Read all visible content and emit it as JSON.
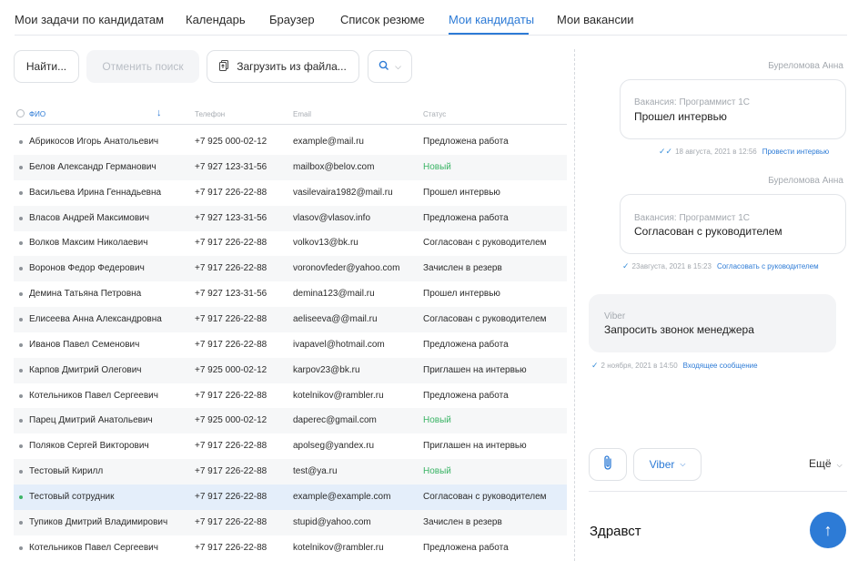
{
  "nav": {
    "tabs": [
      {
        "label": "Мои задачи по кандидатам"
      },
      {
        "label": "Календарь"
      },
      {
        "label": "Браузер"
      },
      {
        "label": "Список резюме"
      },
      {
        "label": "Мои кандидаты",
        "active": true
      },
      {
        "label": "Мои вакансии"
      }
    ]
  },
  "toolbar": {
    "find_label": "Найти...",
    "cancel_label": "Отменить поиск",
    "upload_label": "Загрузить из файла...",
    "icons": {
      "upload": "file-upload-icon",
      "search": "search-icon"
    }
  },
  "table": {
    "columns": [
      "ФИО",
      "Телефон",
      "Email",
      "Статус"
    ],
    "rows": [
      {
        "name": "Абрикосов Игорь Анатольевич",
        "phone": "+7 925 000-02-12",
        "email": "example@mail.ru",
        "status": "Предложена работа"
      },
      {
        "name": "Белов Александр Германович",
        "phone": "+7 927 123-31-56",
        "email": "mailbox@belov.com",
        "status": "Новый"
      },
      {
        "name": "Васильева Ирина Геннадьевна",
        "phone": "+7 917 226-22-88",
        "email": "vasilevaira1982@mail.ru",
        "status": "Прошел интервью"
      },
      {
        "name": "Власов Андрей Максимович",
        "phone": "+7 927 123-31-56",
        "email": "vlasov@vlasov.info",
        "status": "Предложена работа"
      },
      {
        "name": "Волков Максим Николаевич",
        "phone": "+7 917 226-22-88",
        "email": "volkov13@bk.ru",
        "status": "Согласован с руководителем"
      },
      {
        "name": "Воронов Федор Федерович",
        "phone": "+7 917 226-22-88",
        "email": "voronovfeder@yahoo.com",
        "status": "Зачислен в резерв"
      },
      {
        "name": "Демина Татьяна Петровна",
        "phone": "+7 927 123-31-56",
        "email": "demina123@mail.ru",
        "status": "Прошел интервью"
      },
      {
        "name": "Елисеева Анна Александровна",
        "phone": "+7 917 226-22-88",
        "email": "aeliseeva@@mail.ru",
        "status": "Согласован с руководителем"
      },
      {
        "name": "Иванов Павел Семенович",
        "phone": "+7 917 226-22-88",
        "email": "ivapavel@hotmail.com",
        "status": "Предложена работа"
      },
      {
        "name": "Карпов Дмитрий Олегович",
        "phone": "+7 925 000-02-12",
        "email": "karpov23@bk.ru",
        "status": "Приглашен на интервью"
      },
      {
        "name": "Котельников Павел Сергеевич",
        "phone": "+7 917 226-22-88",
        "email": "kotelnikov@rambler.ru",
        "status": "Предложена работа"
      },
      {
        "name": "Парец Дмитрий Анатольевич",
        "phone": "+7 925 000-02-12",
        "email": "daperec@gmail.com",
        "status": "Новый"
      },
      {
        "name": "Поляков Сергей Викторович",
        "phone": "+7 917 226-22-88",
        "email": "apolseg@yandex.ru",
        "status": "Приглашен на интервью"
      },
      {
        "name": "Тестовый Кирилл",
        "phone": "+7 917 226-22-88",
        "email": "test@ya.ru",
        "status": "Новый"
      },
      {
        "name": "Тестовый сотрудник",
        "phone": "+7 917 226-22-88",
        "email": "example@example.com",
        "status": "Согласован с руководителем",
        "selected": true
      },
      {
        "name": "Тупиков Дмитрий Владимирович",
        "phone": "+7 917 226-22-88",
        "email": "stupid@yahoo.com",
        "status": "Зачислен в резерв"
      },
      {
        "name": "Котельников Павел Сергеевич",
        "phone": "+7 917 226-22-88",
        "email": "kotelnikov@rambler.ru",
        "status": "Предложена работа"
      }
    ]
  },
  "chat": {
    "messages": [
      {
        "author": "Буреломова Анна",
        "label": "Вакансия: Программист 1С",
        "text": "Прошел интервью",
        "meta": "18 августа, 2021 в 12:56",
        "action": "Провести интервью"
      },
      {
        "author": "Буреломова Анна",
        "label": "Вакансия: Программист 1С",
        "text": "Согласован с руководителем",
        "meta": "23августа, 2021 в 15:23",
        "action": "Согласовать с руководителем"
      },
      {
        "label": "Viber",
        "text": "Запросить звонок менеджера",
        "meta": "2 ноября, 2021 в 14:50",
        "action": "Входящее сообщение"
      }
    ],
    "composer": {
      "channel": "Viber",
      "more_label": "Ещё",
      "input_value": "Здравст",
      "icons": {
        "attach": "paperclip-icon",
        "send": "arrow-up-icon"
      }
    }
  },
  "colors": {
    "accent": "#2d7bd6",
    "status_new": "#3bb466",
    "selected_row": "#e4eefa"
  }
}
